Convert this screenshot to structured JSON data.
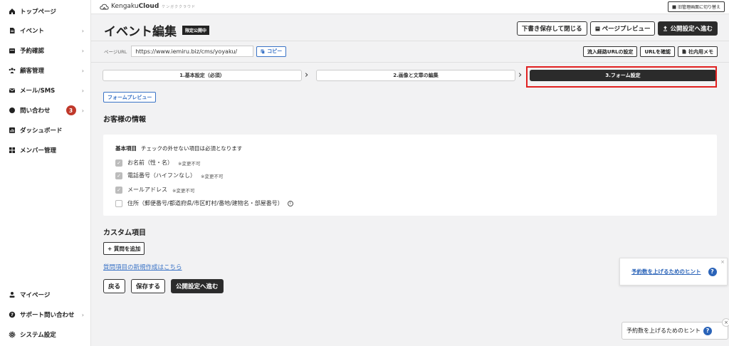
{
  "sidebar": {
    "items": [
      {
        "label": "トップページ",
        "chevron": ""
      },
      {
        "label": "イベント",
        "chevron": "›"
      },
      {
        "label": "予約確認",
        "chevron": "›"
      },
      {
        "label": "顧客管理",
        "chevron": "›"
      },
      {
        "label": "メール/SMS",
        "chevron": "›"
      },
      {
        "label": "問い合わせ",
        "chevron": "›",
        "badge": "3"
      },
      {
        "label": "ダッシュボード",
        "chevron": ""
      },
      {
        "label": "メンバー管理",
        "chevron": ""
      }
    ],
    "bottom": [
      {
        "label": "マイページ",
        "chevron": ""
      },
      {
        "label": "サポート問い合わせ",
        "chevron": "›"
      },
      {
        "label": "システム設定",
        "chevron": ""
      }
    ]
  },
  "topbar": {
    "logo_prefix": "Kengaku",
    "logo_bold": "Cloud",
    "logo_tag": "ケンガククラウド",
    "old_admin_label": "旧管理画面に切り替え"
  },
  "header": {
    "title": "イベント編集",
    "status_badge": "限定公開中",
    "save_draft_label": "下書き保存して閉じる",
    "page_preview_label": "ページプレビュー",
    "publish_settings_label": "公開設定へ進む"
  },
  "url_row": {
    "label": "ページURL",
    "value": "https://www.iemiru.biz/cms/yoyaku/",
    "copy_label": "コピー",
    "inflow_url_label": "流入経路URLの設定",
    "check_url_label": "URLを確認",
    "internal_memo_label": "社内用メモ"
  },
  "steps": [
    {
      "label": "1.基本設定（必須）",
      "active": false
    },
    {
      "label": "2.画像と文章の編集",
      "active": false
    },
    {
      "label": "3.フォーム設定",
      "active": true
    }
  ],
  "form_preview_label": "フォームプレビュー",
  "customer_info": {
    "title": "お客様の情報",
    "basic_title": "基本項目",
    "basic_note": "チェックの外せない項目は必須となります",
    "fields": [
      {
        "label": "お名前（性・名）",
        "note": "※変更不可",
        "checked": true
      },
      {
        "label": "電話番号（ハイフンなし）",
        "note": "※変更不可",
        "checked": true
      },
      {
        "label": "メールアドレス",
        "note": "※変更不可",
        "checked": true
      },
      {
        "label": "住所（郵便番号/都道府県/市区町村/番地/建物名・部屋番号）",
        "note": "",
        "checked": false
      }
    ]
  },
  "custom": {
    "title": "カスタム項目",
    "add_question_label": "+ 質問を追加",
    "new_question_link": "質問項目の新規作成はこちら"
  },
  "footer_buttons": {
    "back_label": "戻る",
    "save_label": "保存する",
    "publish_label": "公開設定へ進む"
  },
  "hints": {
    "hint_link": "予約数を上げるためのヒント",
    "hint_button": "予約数を上げるためのヒント",
    "close": "×",
    "help": "?"
  }
}
